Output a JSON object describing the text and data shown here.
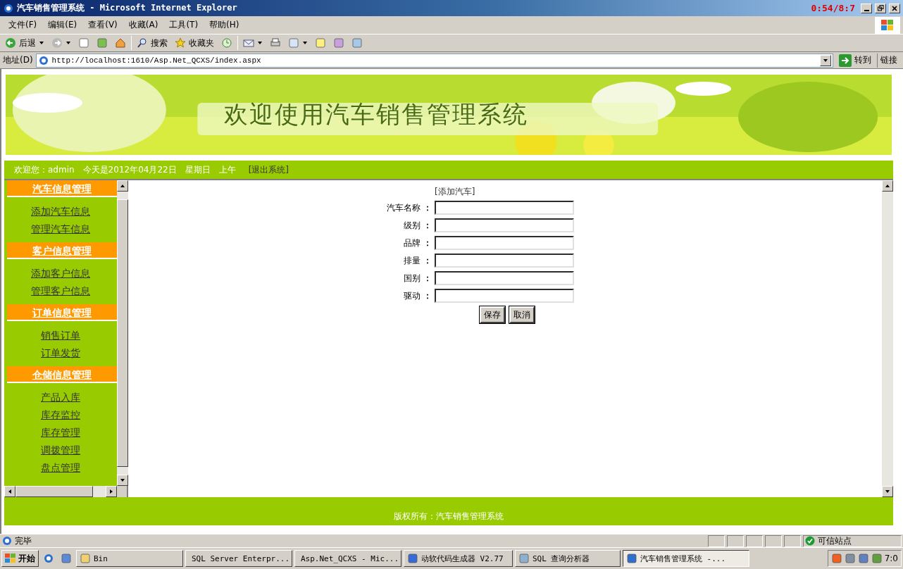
{
  "window": {
    "title": "汽车销售管理系统 - Microsoft Internet Explorer",
    "recorder_time": "0:54/8:7"
  },
  "menu": [
    "文件(F)",
    "编辑(E)",
    "查看(V)",
    "收藏(A)",
    "工具(T)",
    "帮助(H)"
  ],
  "toolbar": {
    "back": "后退",
    "search": "搜索",
    "favorites": "收藏夹"
  },
  "address": {
    "label": "地址(D)",
    "url": "http://localhost:1610/Asp.Net_QCXS/index.aspx",
    "go": "转到",
    "links": "链接"
  },
  "banner": {
    "title": "欢迎使用汽车销售管理系统"
  },
  "welcome": {
    "user": "欢迎您：admin",
    "date": "今天是2012年04月22日",
    "weekday": "星期日",
    "period": "上午",
    "logout": "[退出系统]"
  },
  "sidebar": {
    "sections": [
      {
        "title": "汽车信息管理",
        "items": [
          "添加汽车信息",
          "管理汽车信息"
        ]
      },
      {
        "title": "客户信息管理",
        "items": [
          "添加客户信息",
          "管理客户信息"
        ]
      },
      {
        "title": "订单信息管理",
        "items": [
          "销售订单",
          "订单发货"
        ]
      },
      {
        "title": "仓储信息管理",
        "items": [
          "产品入库",
          "库存监控",
          "库存管理",
          "调拨管理",
          "盘点管理"
        ]
      }
    ]
  },
  "form": {
    "title": "[添加汽车]",
    "fields": [
      {
        "label": "汽车名称",
        "colon": "："
      },
      {
        "label": "级别",
        "colon": "："
      },
      {
        "label": "品牌",
        "colon": "："
      },
      {
        "label": "排量",
        "colon": "："
      },
      {
        "label": "国别",
        "colon": "："
      },
      {
        "label": "驱动",
        "colon": "："
      }
    ],
    "buttons": [
      "保存",
      "取消"
    ]
  },
  "footer": "版权所有：汽车销售管理系统",
  "status": {
    "text": "完毕",
    "zone": "可信站点"
  },
  "taskbar": {
    "start": "开始",
    "tasks": [
      {
        "label": "Bin",
        "selected": false
      },
      {
        "label": "SQL Server Enterpr...",
        "selected": false
      },
      {
        "label": "Asp.Net_QCXS - Mic...",
        "selected": false
      },
      {
        "label": "动软代码生成器  V2.77",
        "selected": false
      },
      {
        "label": "SQL 查询分析器",
        "selected": false
      },
      {
        "label": "汽车销售管理系统 -...",
        "selected": true
      }
    ],
    "clock": "7:0"
  }
}
